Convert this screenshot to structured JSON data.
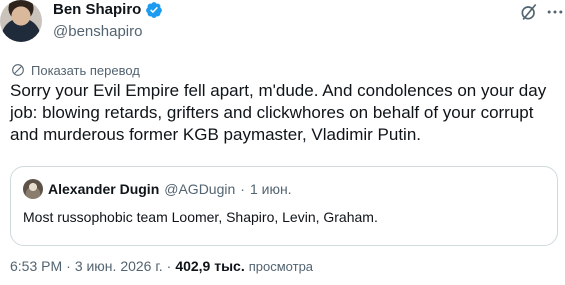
{
  "author": {
    "name": "Ben Shapiro",
    "handle": "@benshapiro"
  },
  "colors": {
    "verified_blue": "#1d9bf0",
    "secondary_text": "#536471",
    "primary_text": "#0f1419",
    "border": "#cfd9de"
  },
  "icons": {
    "verified": "verified-badge-icon",
    "grok": "grok-icon",
    "more": "more-icon",
    "translate": "translate-icon"
  },
  "translate_label": "Показать перевод",
  "tweet_text": "Sorry your Evil Empire fell apart, m'dude. And condolences on your day job: blowing retards, grifters and clickwhores on behalf of your corrupt and murderous former KGB paymaster, Vladimir Putin.",
  "quote": {
    "name": "Alexander Dugin",
    "handle": "@AGDugin",
    "separator": "·",
    "date": "1 июн.",
    "text": "Most russophobic team Loomer, Shapiro, Levin, Graham."
  },
  "meta": {
    "time": "6:53 PM",
    "separator": "·",
    "date": "3 июн. 2026 г.",
    "separator2": "·",
    "views_count": "402,9 тыс.",
    "views_label": "просмотра"
  }
}
